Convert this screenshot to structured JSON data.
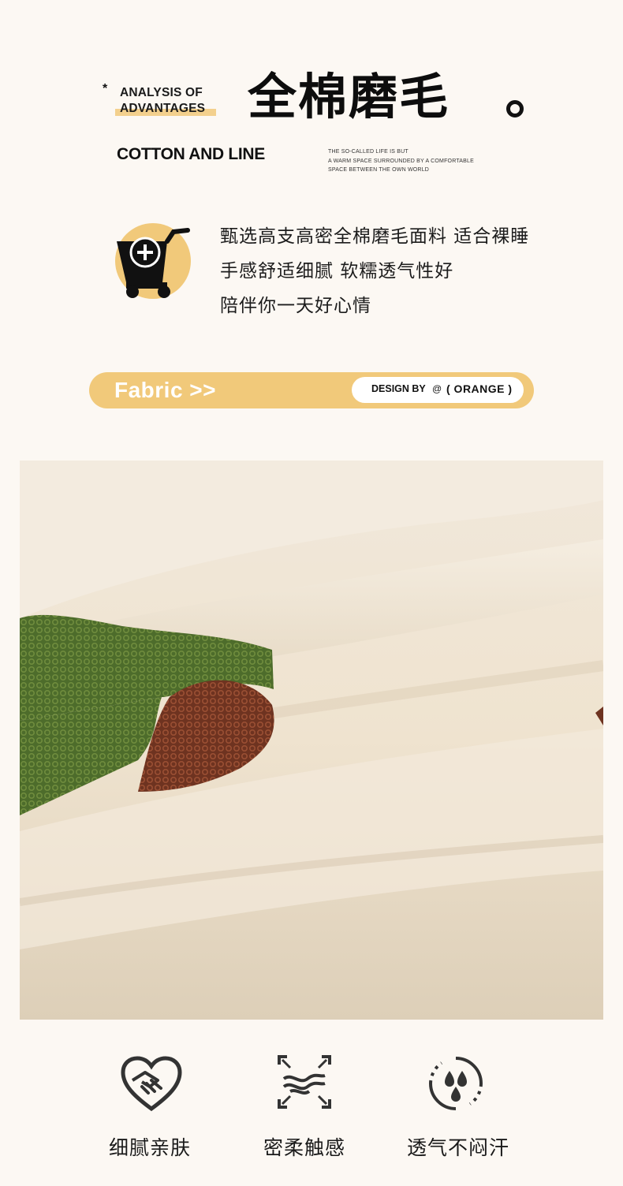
{
  "header": {
    "asterisk": "*",
    "analysis_line1": "ANALYSIS OF",
    "analysis_line2": "ADVANTAGES",
    "main_title": "全棉磨毛",
    "subtitle": "COTTON AND LINE",
    "small_text": [
      "THE SO-CALLED LIFE IS BUT",
      "A WARM SPACE SURROUNDED BY A COMFORTABLE",
      "SPACE BETWEEN THE OWN WORLD"
    ]
  },
  "description": {
    "icon": "cart-add-icon",
    "lines": [
      "甄选高支高密全棉磨毛面料 适合裸睡",
      "手感舒适细腻 软糯透气性好",
      "陪伴你一天好心情"
    ]
  },
  "fabric_bar": {
    "label": "Fabric >>",
    "design_by": "DESIGN BY",
    "at": "@",
    "brand": "( ORANGE )"
  },
  "features": [
    {
      "icon": "handshake-heart-icon",
      "label": "细腻亲肤"
    },
    {
      "icon": "soft-touch-icon",
      "label": "密柔触感"
    },
    {
      "icon": "breathable-drops-icon",
      "label": "透气不闷汗"
    }
  ],
  "colors": {
    "accent": "#f1c97a",
    "background": "#fcf8f3",
    "fabric_cream": "#efe4d3",
    "embroidery_green": "#4a6b2a",
    "embroidery_brown": "#7a3a22"
  }
}
